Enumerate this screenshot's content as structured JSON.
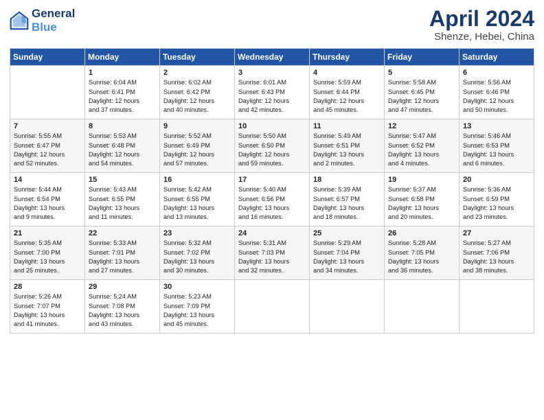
{
  "header": {
    "logo_line1": "General",
    "logo_line2": "Blue",
    "month_title": "April 2024",
    "subtitle": "Shenze, Hebei, China"
  },
  "days_of_week": [
    "Sunday",
    "Monday",
    "Tuesday",
    "Wednesday",
    "Thursday",
    "Friday",
    "Saturday"
  ],
  "weeks": [
    [
      {
        "num": "",
        "info": ""
      },
      {
        "num": "1",
        "info": "Sunrise: 6:04 AM\nSunset: 6:41 PM\nDaylight: 12 hours\nand 37 minutes."
      },
      {
        "num": "2",
        "info": "Sunrise: 6:02 AM\nSunset: 6:42 PM\nDaylight: 12 hours\nand 40 minutes."
      },
      {
        "num": "3",
        "info": "Sunrise: 6:01 AM\nSunset: 6:43 PM\nDaylight: 12 hours\nand 42 minutes."
      },
      {
        "num": "4",
        "info": "Sunrise: 5:59 AM\nSunset: 6:44 PM\nDaylight: 12 hours\nand 45 minutes."
      },
      {
        "num": "5",
        "info": "Sunrise: 5:58 AM\nSunset: 6:45 PM\nDaylight: 12 hours\nand 47 minutes."
      },
      {
        "num": "6",
        "info": "Sunrise: 5:56 AM\nSunset: 6:46 PM\nDaylight: 12 hours\nand 50 minutes."
      }
    ],
    [
      {
        "num": "7",
        "info": "Sunrise: 5:55 AM\nSunset: 6:47 PM\nDaylight: 12 hours\nand 52 minutes."
      },
      {
        "num": "8",
        "info": "Sunrise: 5:53 AM\nSunset: 6:48 PM\nDaylight: 12 hours\nand 54 minutes."
      },
      {
        "num": "9",
        "info": "Sunrise: 5:52 AM\nSunset: 6:49 PM\nDaylight: 12 hours\nand 57 minutes."
      },
      {
        "num": "10",
        "info": "Sunrise: 5:50 AM\nSunset: 6:50 PM\nDaylight: 12 hours\nand 59 minutes."
      },
      {
        "num": "11",
        "info": "Sunrise: 5:49 AM\nSunset: 6:51 PM\nDaylight: 13 hours\nand 2 minutes."
      },
      {
        "num": "12",
        "info": "Sunrise: 5:47 AM\nSunset: 6:52 PM\nDaylight: 13 hours\nand 4 minutes."
      },
      {
        "num": "13",
        "info": "Sunrise: 5:46 AM\nSunset: 6:53 PM\nDaylight: 13 hours\nand 6 minutes."
      }
    ],
    [
      {
        "num": "14",
        "info": "Sunrise: 5:44 AM\nSunset: 6:54 PM\nDaylight: 13 hours\nand 9 minutes."
      },
      {
        "num": "15",
        "info": "Sunrise: 5:43 AM\nSunset: 6:55 PM\nDaylight: 13 hours\nand 11 minutes."
      },
      {
        "num": "16",
        "info": "Sunrise: 5:42 AM\nSunset: 6:55 PM\nDaylight: 13 hours\nand 13 minutes."
      },
      {
        "num": "17",
        "info": "Sunrise: 5:40 AM\nSunset: 6:56 PM\nDaylight: 13 hours\nand 16 minutes."
      },
      {
        "num": "18",
        "info": "Sunrise: 5:39 AM\nSunset: 6:57 PM\nDaylight: 13 hours\nand 18 minutes."
      },
      {
        "num": "19",
        "info": "Sunrise: 5:37 AM\nSunset: 6:58 PM\nDaylight: 13 hours\nand 20 minutes."
      },
      {
        "num": "20",
        "info": "Sunrise: 5:36 AM\nSunset: 6:59 PM\nDaylight: 13 hours\nand 23 minutes."
      }
    ],
    [
      {
        "num": "21",
        "info": "Sunrise: 5:35 AM\nSunset: 7:00 PM\nDaylight: 13 hours\nand 25 minutes."
      },
      {
        "num": "22",
        "info": "Sunrise: 5:33 AM\nSunset: 7:01 PM\nDaylight: 13 hours\nand 27 minutes."
      },
      {
        "num": "23",
        "info": "Sunrise: 5:32 AM\nSunset: 7:02 PM\nDaylight: 13 hours\nand 30 minutes."
      },
      {
        "num": "24",
        "info": "Sunrise: 5:31 AM\nSunset: 7:03 PM\nDaylight: 13 hours\nand 32 minutes."
      },
      {
        "num": "25",
        "info": "Sunrise: 5:29 AM\nSunset: 7:04 PM\nDaylight: 13 hours\nand 34 minutes."
      },
      {
        "num": "26",
        "info": "Sunrise: 5:28 AM\nSunset: 7:05 PM\nDaylight: 13 hours\nand 36 minutes."
      },
      {
        "num": "27",
        "info": "Sunrise: 5:27 AM\nSunset: 7:06 PM\nDaylight: 13 hours\nand 38 minutes."
      }
    ],
    [
      {
        "num": "28",
        "info": "Sunrise: 5:26 AM\nSunset: 7:07 PM\nDaylight: 13 hours\nand 41 minutes."
      },
      {
        "num": "29",
        "info": "Sunrise: 5:24 AM\nSunset: 7:08 PM\nDaylight: 13 hours\nand 43 minutes."
      },
      {
        "num": "30",
        "info": "Sunrise: 5:23 AM\nSunset: 7:09 PM\nDaylight: 13 hours\nand 45 minutes."
      },
      {
        "num": "",
        "info": ""
      },
      {
        "num": "",
        "info": ""
      },
      {
        "num": "",
        "info": ""
      },
      {
        "num": "",
        "info": ""
      }
    ]
  ]
}
